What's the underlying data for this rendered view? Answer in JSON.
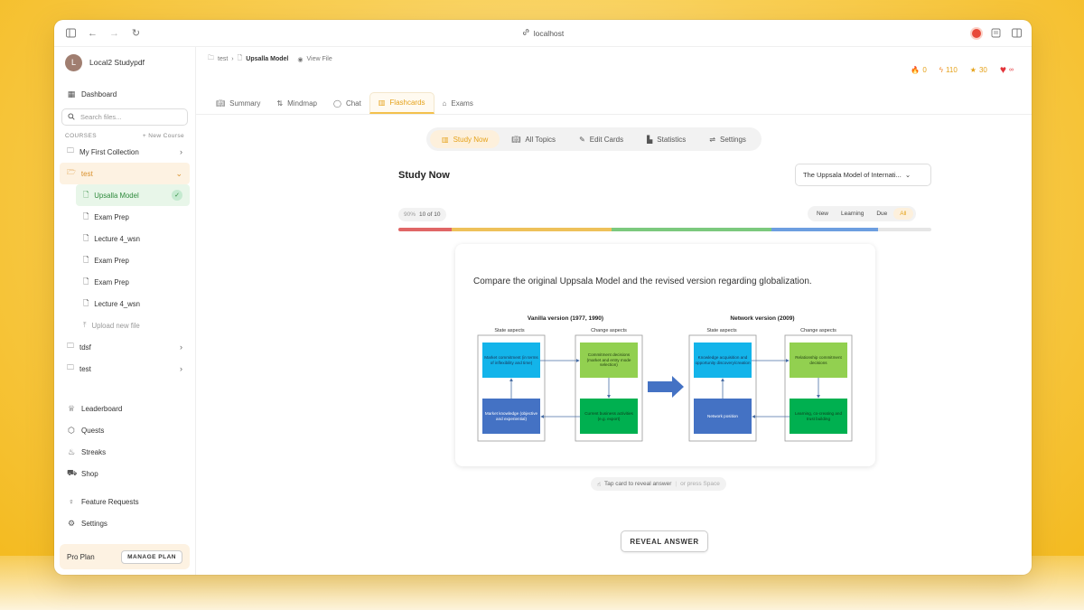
{
  "browser": {
    "url": "localhost"
  },
  "sidebar": {
    "profile": {
      "initial": "L",
      "name": "Local2 Studypdf"
    },
    "dashboard": "Dashboard",
    "search_placeholder": "Search files...",
    "courses_label": "COURSES",
    "new_course": "+ New Course",
    "courses": [
      {
        "label": "My First Collection"
      },
      {
        "label": "test",
        "open": true,
        "files": [
          "Upsalla Model",
          "Exam Prep",
          "Lecture 4_wsn",
          "Exam Prep",
          "Exam Prep",
          "Lecture 4_wsn"
        ],
        "upload": "Upload new file"
      },
      {
        "label": "tdsf"
      },
      {
        "label": "test"
      }
    ],
    "links": [
      "Leaderboard",
      "Quests",
      "Streaks",
      "Shop"
    ],
    "links2": [
      "Feature Requests",
      "Settings"
    ],
    "plan": {
      "name": "Pro Plan",
      "button": "MANAGE PLAN"
    }
  },
  "breadcrumb": {
    "folder": "test",
    "file": "Upsalla Model",
    "view": "View File"
  },
  "stats": {
    "streak": "0",
    "energy": "110",
    "stars": "30",
    "hearts": "∞"
  },
  "tabs": [
    "Summary",
    "Mindmap",
    "Chat",
    "Flashcards",
    "Exams"
  ],
  "subnav": [
    "Study Now",
    "All Topics",
    "Edit Cards",
    "Statistics",
    "Settings"
  ],
  "study": {
    "title": "Study Now",
    "deck": "The Uppsala Model of Internati...",
    "progress_pct": "90%",
    "progress_count": "10 of 10",
    "filters": [
      "New",
      "Learning",
      "Due",
      "All"
    ]
  },
  "colors": {
    "bar_red": "#e06666",
    "bar_yellow": "#eec15a",
    "bar_green": "#7cc97e",
    "bar_blue": "#6d9ee0",
    "bar_gray": "#e6e6e6"
  },
  "card": {
    "question": "Compare the original Uppsala Model and the revised version regarding globalization.",
    "figure": {
      "left_title": "Vanilla version (1977, 1990)",
      "right_title": "Network version (2009)",
      "state": "State aspects",
      "change": "Change aspects",
      "boxes": {
        "mc": "Market commitment (in terms of inflexibility and time)",
        "cd": "Commitment decisions (market and entry mode selection)",
        "mk": "Market knowledge (objective and experiential)",
        "cba": "Current business activities (e.g. export)",
        "ka": "Knowledge acquisition and opportunity discovery/creation",
        "rc": "Relationship commitment decisions",
        "np": "Network position",
        "lc": "Learning, co-creating and trust building"
      }
    }
  },
  "hint": {
    "text": "Tap card to reveal answer",
    "alt": "or press Space"
  },
  "reveal": "REVEAL ANSWER"
}
